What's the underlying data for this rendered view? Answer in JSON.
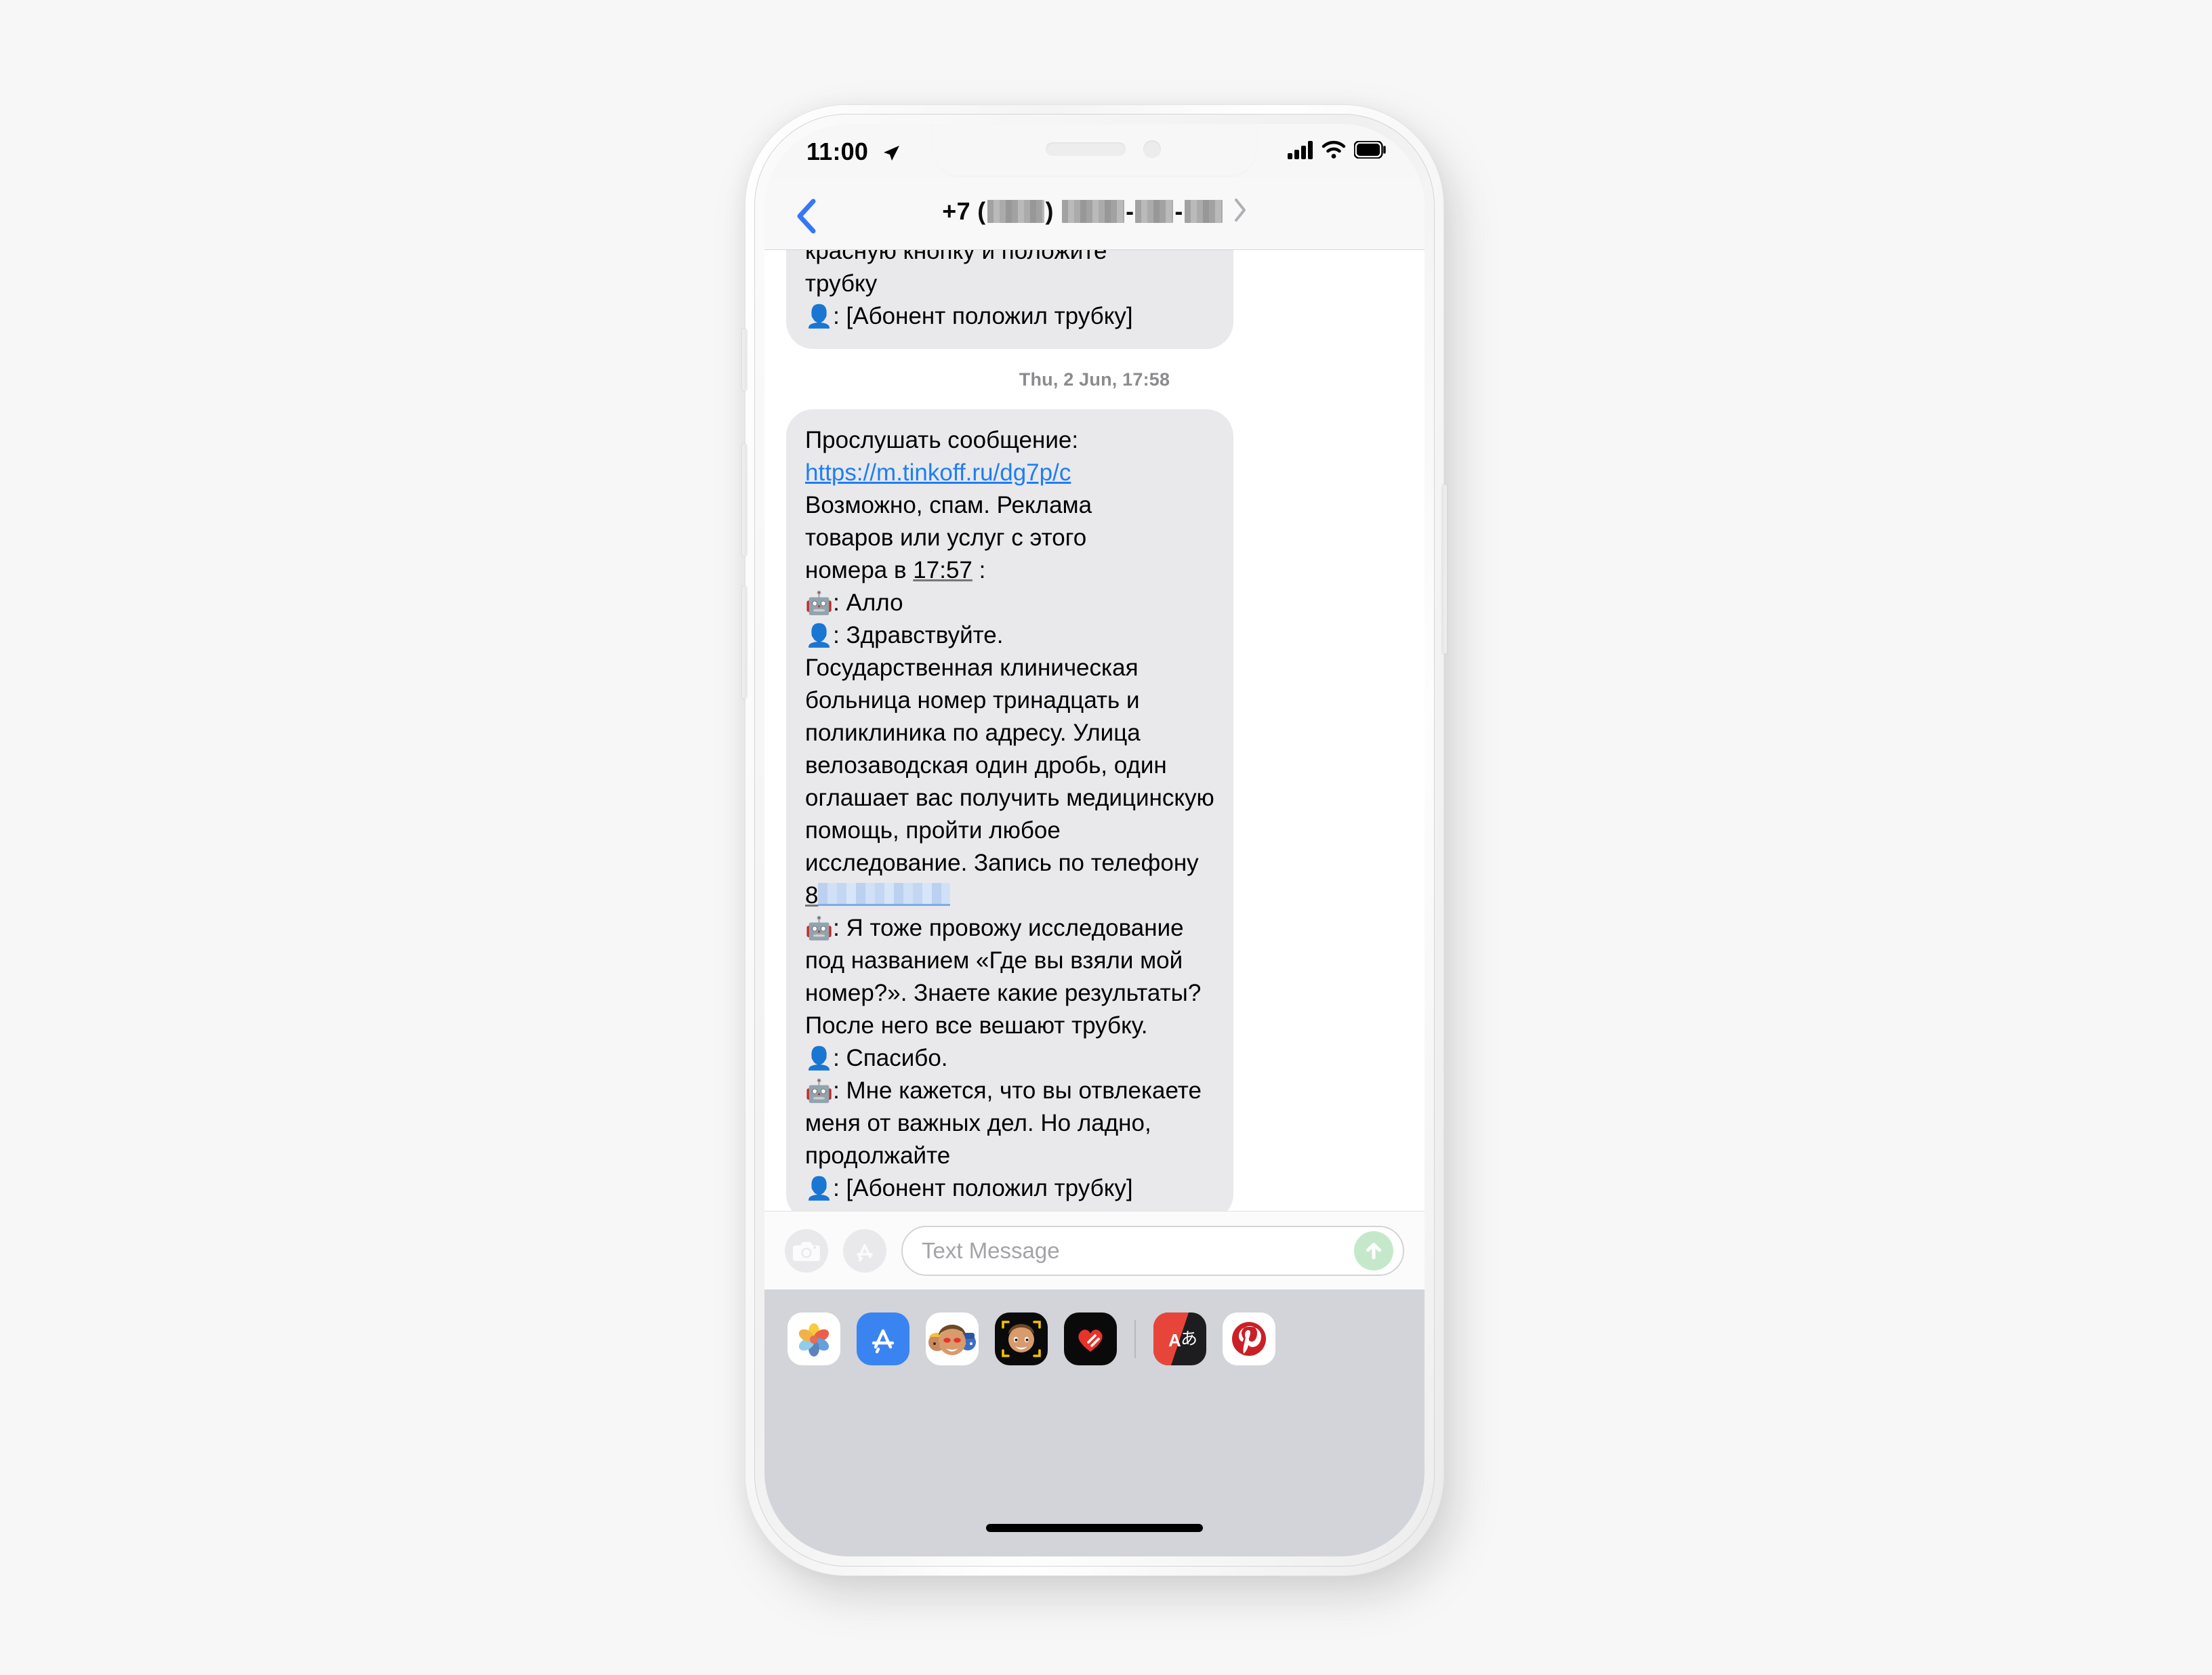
{
  "status_bar": {
    "time": "11:00",
    "location_icon": "location-arrow-icon",
    "cellular_icon": "cellular-signal-icon",
    "wifi_icon": "wifi-icon",
    "battery_icon": "battery-full-icon"
  },
  "nav_header": {
    "back_icon": "chevron-left-icon",
    "title_prefix": "+7 (",
    "title_mid": ")",
    "title_sep": "-",
    "detail_icon": "chevron-right-icon",
    "redacted": true
  },
  "conversation": {
    "previous_bubble": {
      "text_line_1": "красную кнопку и положите",
      "text_line_2": "трубку",
      "speaker_emoji": "👤",
      "text_line_3": ": [Абонент положил трубку]",
      "clipped_top": true
    },
    "timestamp": "Thu, 2 Jun, 17:58",
    "main_bubble": {
      "intro": "Прослушать сообщение:",
      "link": "https://m.tinkoff.ru/dg7p/c",
      "spam_notice_a": "Возможно, спам. Реклама",
      "spam_notice_b": "товаров или услуг с этого",
      "spam_notice_c": "номера в ",
      "spam_time": "17:57",
      "spam_notice_d": " :",
      "lines": [
        {
          "emoji": "🤖",
          "text": ": Алло"
        },
        {
          "emoji": "👤",
          "text": ": Здравствуйте."
        },
        {
          "emoji": "",
          "text": "Государственная клиническая больница номер тринадцать и поликлиника по адресу. Улица велозаводская один дробь, один оглашает вас получить медицинскую помощь, пройти любое исследование. Запись по телефону "
        },
        {
          "emoji": "🤖",
          "text": ": Я тоже провожу исследование под названием «Где вы взяли мой номер?». Знаете какие результаты? После него все вешают трубку."
        },
        {
          "emoji": "👤",
          "text": ": Спасибо."
        },
        {
          "emoji": "🤖",
          "text": ": Мне кажется, что вы отвлекаете меня от важных дел. Но ладно, продолжайте"
        },
        {
          "emoji": "👤",
          "text": ": [Абонент положил трубку]"
        }
      ],
      "phone_prefix": "8",
      "phone_redacted": true
    }
  },
  "input_bar": {
    "camera_icon": "camera-icon",
    "appstore_icon": "app-store-icon",
    "placeholder": "Text Message",
    "send_icon": "send-arrow-up-icon"
  },
  "app_drawer": {
    "apps": [
      {
        "name": "photos-app-icon",
        "label": "Photos"
      },
      {
        "name": "app-store-app-icon",
        "label": "App Store"
      },
      {
        "name": "memoji-stickers-app-icon",
        "label": "Memoji Stickers"
      },
      {
        "name": "memoji-app-icon",
        "label": "Memoji"
      },
      {
        "name": "digital-touch-app-icon",
        "label": "Digital Touch"
      },
      {
        "name": "translate-app-icon",
        "label": "Translate"
      },
      {
        "name": "pinterest-app-icon",
        "label": "Pinterest"
      }
    ],
    "home_indicator": "home-indicator"
  },
  "colors": {
    "page_background": "#f7f7f7",
    "bubble_gray": "#e9e9eb",
    "link_blue": "#1d7ef5",
    "accent_blue": "#3478f6",
    "drawer_gray": "#d2d4d9",
    "send_green": "#c5e8ca",
    "timestamp_gray": "#8b8b8e"
  }
}
